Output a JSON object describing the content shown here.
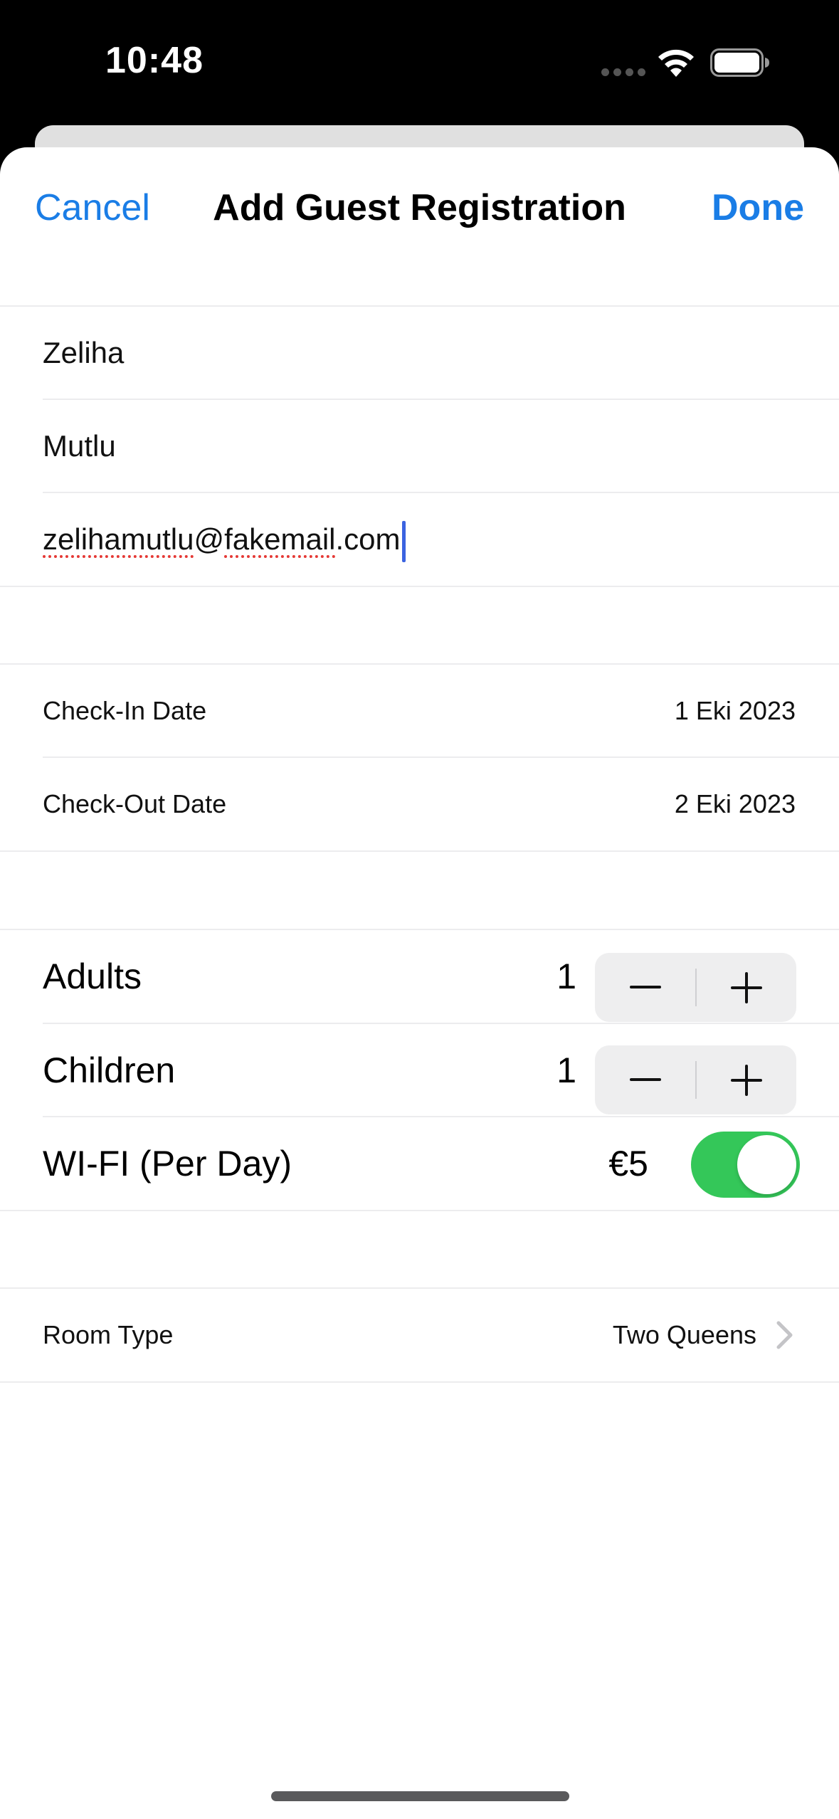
{
  "status_bar": {
    "time": "10:48",
    "icons": [
      "signal-dots-icon",
      "wifi-icon",
      "battery-icon"
    ]
  },
  "nav": {
    "cancel_label": "Cancel",
    "title": "Add Guest Registration",
    "done_label": "Done"
  },
  "guest": {
    "first_name": "Zeliha",
    "last_name": "Mutlu",
    "email_misspelled_1": "zelihamutlu",
    "email_at": "@",
    "email_misspelled_2": "fakemail",
    "email_rest": ".com"
  },
  "dates": {
    "check_in_label": "Check-In Date",
    "check_in_value": "1 Eki 2023",
    "check_out_label": "Check-Out Date",
    "check_out_value": "2 Eki 2023"
  },
  "occupancy": {
    "adults_label": "Adults",
    "adults_value": "1",
    "children_label": "Children",
    "children_value": "1",
    "stepper_minus": "minus-icon",
    "stepper_plus": "plus-icon"
  },
  "wifi": {
    "label": "WI-FI (Per Day)",
    "price": "€5",
    "enabled": true
  },
  "room": {
    "label": "Room Type",
    "value": "Two Queens"
  },
  "colors": {
    "accent": "#1a7de6",
    "toggle_on": "#34c759",
    "spellcheck": "#e53935",
    "cursor": "#3b63e0"
  }
}
